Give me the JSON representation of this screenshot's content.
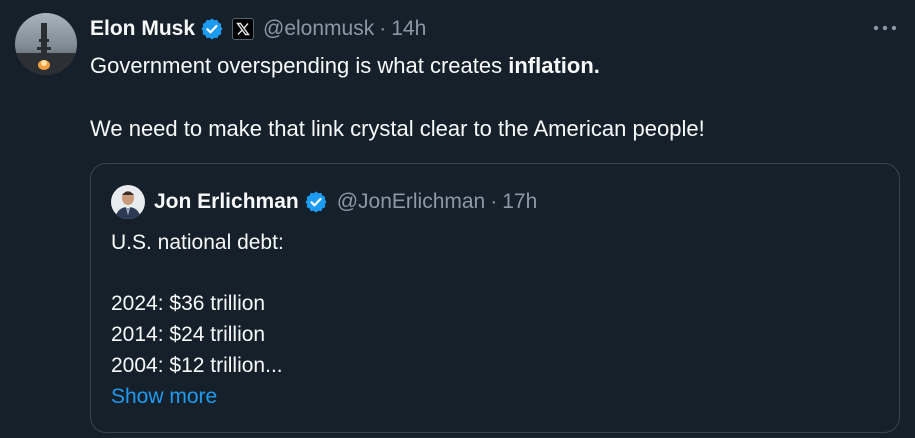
{
  "tweet": {
    "author_name": "Elon Musk",
    "handle": "@elonmusk",
    "separator": "·",
    "time": "14h",
    "text_line1_prefix": "Government overspending is what creates ",
    "text_line1_bold": "inflation",
    "text_line1_suffix": ".",
    "text_line2": "We need to make that link crystal clear to the American people!"
  },
  "quoted": {
    "author_name": "Jon Erlichman",
    "handle": "@JonErlichman",
    "separator": "·",
    "time": "17h",
    "lines": [
      "U.S. national debt:",
      "2024: $36 trillion",
      "2014: $24 trillion",
      "2004: $12 trillion..."
    ],
    "show_more": "Show more"
  },
  "icons": {
    "verified": "verified-badge-icon",
    "affiliation": "x-logo-icon",
    "more": "more-options-icon"
  },
  "colors": {
    "background": "#15202b",
    "text": "#f7f9f9",
    "secondary": "#8b98a5",
    "accent": "#1d9bf0",
    "border": "#38444d"
  }
}
